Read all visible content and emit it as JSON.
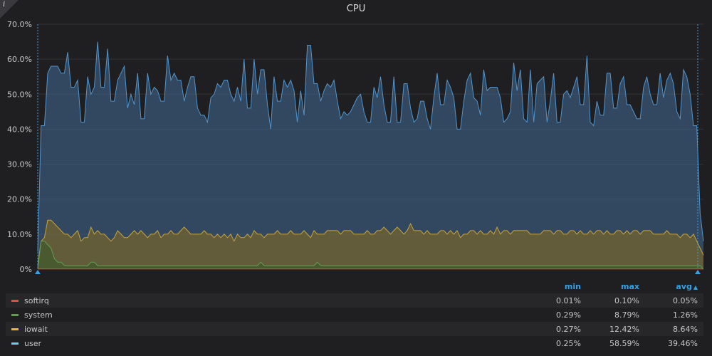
{
  "panel": {
    "title": "CPU"
  },
  "legend": {
    "headers": {
      "min": "min",
      "max": "max",
      "avg": "avg"
    },
    "sort_icon": "caret-up-icon",
    "rows": [
      {
        "name": "softirq",
        "color": "#e24d42",
        "min": "0.01%",
        "max": "0.10%",
        "avg": "0.05%"
      },
      {
        "name": "system",
        "color": "#629e51",
        "min": "0.29%",
        "max": "8.79%",
        "avg": "1.26%"
      },
      {
        "name": "iowait",
        "color": "#eab839",
        "min": "0.27%",
        "max": "12.42%",
        "avg": "8.64%"
      },
      {
        "name": "user",
        "color": "#6ed0e0",
        "min": "0.25%",
        "max": "58.59%",
        "avg": "39.46%"
      }
    ]
  },
  "chart_data": {
    "type": "area",
    "stacked": false,
    "title": "CPU",
    "ylim": [
      0,
      70
    ],
    "yticks": [
      "0%",
      "10.0%",
      "20.0%",
      "30.0%",
      "40.0%",
      "50.0%",
      "60.0%",
      "70.0%"
    ],
    "ytick_values": [
      0,
      10,
      20,
      30,
      40,
      50,
      60,
      70
    ],
    "grid": true,
    "x_count": 200,
    "series": [
      {
        "name": "user",
        "color": "#5195ce",
        "values": [
          5,
          41,
          41,
          56,
          58,
          58,
          58,
          56,
          56,
          62,
          52,
          52,
          54,
          42,
          42,
          55,
          50,
          52,
          65,
          52,
          52,
          63,
          48,
          48,
          54,
          56,
          58,
          46,
          50,
          47,
          56,
          43,
          43,
          56,
          50,
          52,
          51,
          48,
          48,
          61,
          54,
          56,
          54,
          54,
          48,
          52,
          55,
          55,
          46,
          44,
          44,
          42,
          49,
          50,
          53,
          52,
          54,
          54,
          50,
          48,
          52,
          48,
          60,
          46,
          46,
          60,
          50,
          57,
          57,
          47,
          40,
          55,
          48,
          48,
          54,
          52,
          54,
          51,
          42,
          51,
          44,
          64,
          64,
          53,
          53,
          48,
          51,
          53,
          52,
          54,
          48,
          43,
          45,
          44,
          45,
          47,
          49,
          50,
          45,
          42,
          42,
          52,
          49,
          55,
          47,
          42,
          42,
          55,
          42,
          42,
          53,
          53,
          46,
          42,
          43,
          48,
          48,
          43,
          40,
          49,
          56,
          47,
          47,
          54,
          52,
          49,
          40,
          40,
          48,
          54,
          56,
          49,
          48,
          44,
          57,
          51,
          52,
          52,
          52,
          49,
          42,
          43,
          45,
          59,
          51,
          57,
          43,
          42,
          57,
          42,
          53,
          54,
          55,
          42,
          48,
          56,
          42,
          42,
          50,
          51,
          49,
          52,
          55,
          47,
          47,
          61,
          42,
          41,
          48,
          44,
          44,
          56,
          56,
          46,
          46,
          53,
          55,
          47,
          47,
          45,
          43,
          43,
          52,
          55,
          50,
          47,
          47,
          56,
          49,
          54,
          56,
          53,
          45,
          43,
          57,
          55,
          50,
          41,
          41,
          16,
          8
        ],
        "note": "approximate user CPU % over time"
      },
      {
        "name": "iowait",
        "color": "#eab839",
        "values": [
          1,
          8,
          9,
          14,
          14,
          13,
          12,
          11,
          10,
          10,
          9,
          10,
          11,
          8,
          9,
          9,
          12,
          10,
          11,
          10,
          10,
          9,
          8,
          9,
          11,
          10,
          9,
          9,
          10,
          11,
          10,
          11,
          10,
          9,
          10,
          10,
          11,
          9,
          10,
          10,
          11,
          10,
          10,
          11,
          12,
          11,
          10,
          10,
          10,
          10,
          11,
          10,
          10,
          9,
          10,
          9,
          10,
          9,
          10,
          8,
          10,
          9,
          9,
          10,
          9,
          11,
          10,
          10,
          9,
          10,
          10,
          10,
          11,
          10,
          10,
          10,
          11,
          10,
          10,
          10,
          11,
          10,
          9,
          11,
          10,
          10,
          10,
          11,
          11,
          11,
          11,
          10,
          11,
          11,
          11,
          10,
          10,
          10,
          10,
          11,
          10,
          10,
          11,
          11,
          12,
          11,
          10,
          11,
          12,
          11,
          10,
          11,
          13,
          11,
          11,
          11,
          10,
          11,
          10,
          10,
          10,
          11,
          11,
          10,
          11,
          10,
          11,
          9,
          10,
          10,
          11,
          11,
          10,
          11,
          10,
          10,
          11,
          10,
          12,
          10,
          11,
          11,
          10,
          11,
          11,
          11,
          11,
          11,
          10,
          10,
          10,
          10,
          11,
          11,
          11,
          10,
          11,
          11,
          10,
          10,
          11,
          11,
          10,
          11,
          10,
          10,
          11,
          10,
          11,
          11,
          10,
          11,
          10,
          10,
          11,
          11,
          10,
          11,
          10,
          11,
          11,
          10,
          11,
          11,
          11,
          10,
          10,
          10,
          10,
          11,
          10,
          10,
          10,
          9,
          10,
          10,
          9,
          10,
          8,
          6,
          4
        ]
      },
      {
        "name": "system",
        "color": "#629e51",
        "values": [
          0,
          8,
          8,
          7,
          6,
          3,
          2,
          2,
          1,
          1,
          1,
          1,
          1,
          1,
          1,
          1,
          2,
          2,
          1,
          1,
          1,
          1,
          1,
          1,
          1,
          1,
          1,
          1,
          1,
          1,
          1,
          1,
          1,
          1,
          1,
          1,
          1,
          1,
          1,
          1,
          1,
          1,
          1,
          1,
          1,
          1,
          1,
          1,
          1,
          1,
          1,
          1,
          1,
          1,
          1,
          1,
          1,
          1,
          1,
          1,
          1,
          1,
          1,
          1,
          1,
          1,
          1,
          2,
          1,
          1,
          1,
          1,
          1,
          1,
          1,
          1,
          1,
          1,
          1,
          1,
          1,
          1,
          1,
          1,
          2,
          1,
          1,
          1,
          1,
          1,
          1,
          1,
          1,
          1,
          1,
          1,
          1,
          1,
          1,
          1,
          1,
          1,
          1,
          1,
          1,
          1,
          1,
          1,
          1,
          1,
          1,
          1,
          1,
          1,
          1,
          1,
          1,
          1,
          1,
          1,
          1,
          1,
          1,
          1,
          1,
          1,
          1,
          1,
          1,
          1,
          1,
          1,
          1,
          1,
          1,
          1,
          1,
          1,
          1,
          1,
          1,
          1,
          1,
          1,
          1,
          1,
          1,
          1,
          1,
          1,
          1,
          1,
          1,
          1,
          1,
          1,
          1,
          1,
          1,
          1,
          1,
          1,
          1,
          1,
          1,
          1,
          1,
          1,
          1,
          1,
          1,
          1,
          1,
          1,
          1,
          1,
          1,
          1,
          1,
          1,
          1,
          1,
          1,
          1,
          1,
          1,
          1,
          1,
          1,
          1,
          1,
          1,
          1,
          1,
          1,
          1,
          1,
          1,
          1,
          1,
          0
        ]
      },
      {
        "name": "softirq",
        "color": "#e24d42",
        "values": [
          0.05,
          0.05,
          0.05,
          0.05,
          0.05,
          0.05,
          0.05,
          0.05,
          0.05,
          0.05
        ]
      }
    ]
  }
}
